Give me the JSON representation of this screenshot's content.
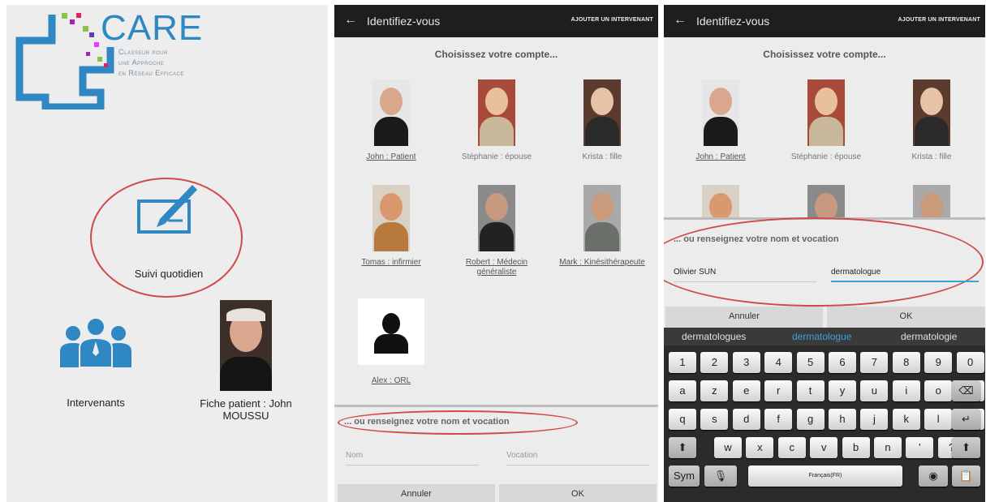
{
  "colors": {
    "brand_blue": "#2f87c4",
    "highlight_red": "#d04a4a",
    "appbar_bg": "#1e1e1e",
    "focus_underline": "#3ba3d9"
  },
  "panel1": {
    "logo": {
      "name": "CARE",
      "tagline": [
        "Classeur pour",
        "une Approche",
        "en Réseau Efficace"
      ]
    },
    "suivi_label": "Suivi quotidien",
    "intervenants_label": "Intervenants",
    "fiche_label": "Fiche patient : John MOUSSU"
  },
  "panel2": {
    "appbar": {
      "title": "Identifiez-vous",
      "action": "AJOUTER UN INTERVENANT"
    },
    "heading": "Choisissez votre compte...",
    "accounts": [
      {
        "label": "John : Patient",
        "link": true
      },
      {
        "label": "Stéphanie : épouse",
        "link": false
      },
      {
        "label": "Krista : fille",
        "link": false
      },
      {
        "label": "Tomas : infirmier",
        "link": true
      },
      {
        "label": "Robert : Médecin généraliste",
        "link": true
      },
      {
        "label": "Mark : Kinésithérapeute",
        "link": true
      },
      {
        "label": "Alex : ORL",
        "link": true
      }
    ],
    "section_label": "... ou renseignez votre nom et vocation",
    "name_placeholder": "Nom",
    "vocation_placeholder": "Vocation",
    "cancel": "Annuler",
    "ok": "OK"
  },
  "panel3": {
    "appbar": {
      "title": "Identifiez-vous",
      "action": "AJOUTER UN INTERVENANT"
    },
    "heading": "Choisissez votre compte...",
    "accounts": [
      {
        "label": "John : Patient",
        "link": true
      },
      {
        "label": "Stéphanie : épouse",
        "link": false
      },
      {
        "label": "Krista : fille",
        "link": false
      }
    ],
    "section_label": "... ou renseignez votre nom et vocation",
    "name_value": "Olivier SUN",
    "vocation_value": "dermatologue",
    "cancel": "Annuler",
    "ok": "OK",
    "keyboard": {
      "suggestions": [
        "dermatologues",
        "dermatologue",
        "dermatologie"
      ],
      "row_numbers": [
        "1",
        "2",
        "3",
        "4",
        "5",
        "6",
        "7",
        "8",
        "9",
        "0"
      ],
      "row1": [
        "a",
        "z",
        "e",
        "r",
        "t",
        "y",
        "u",
        "i",
        "o",
        "p"
      ],
      "row2": [
        "q",
        "s",
        "d",
        "f",
        "g",
        "h",
        "j",
        "k",
        "l",
        "m"
      ],
      "row3": [
        "w",
        "x",
        "c",
        "v",
        "b",
        "n",
        "'",
        "?"
      ],
      "sym": "Sym",
      "space_label": "Français(FR)",
      "backspace_icon": "⌫",
      "enter_icon": "↵",
      "shift_icon": "⬆",
      "mic_icon": "🎙",
      "globe_icon": "◉",
      "clipboard_icon": "📋"
    }
  }
}
